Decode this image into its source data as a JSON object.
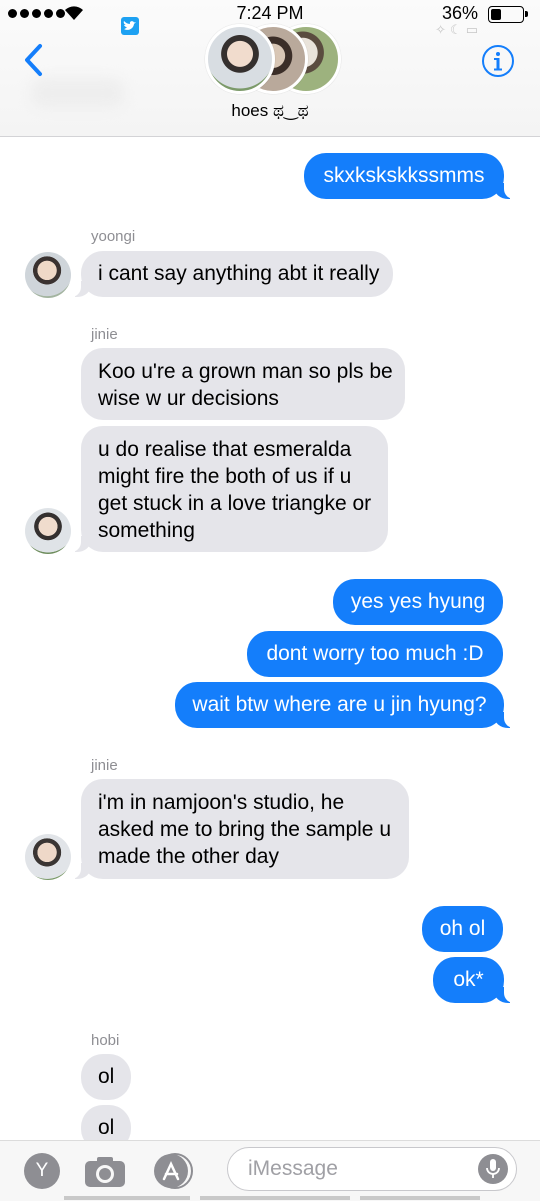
{
  "status_bar": {
    "time": "7:24 PM",
    "battery": "36%"
  },
  "header": {
    "title": "hoes ಥ‿ಥ"
  },
  "messages": [
    {
      "text": "skxkskskkssmms"
    },
    {
      "sender": "yoongi",
      "text": "i cant say anything abt it really"
    },
    {
      "sender": "jinie",
      "lines": [
        "Koo u're a grown man so pls be",
        "wise w ur decisions"
      ]
    },
    {
      "lines": [
        "u do realise that esmeralda",
        "might fire the both of us if u",
        "get stuck in a love triangke or",
        "something"
      ]
    },
    {
      "text": "yes yes hyung"
    },
    {
      "text": "dont worry too much :D"
    },
    {
      "text": "wait btw where are u jin hyung?"
    },
    {
      "sender": "jinie",
      "lines": [
        "i'm in namjoon's studio, he",
        "asked me to bring the sample u",
        "made the other day"
      ]
    },
    {
      "text": "oh ol"
    },
    {
      "text": "ok*"
    },
    {
      "sender": "hobi",
      "text": "ol"
    },
    {
      "text": "ol"
    }
  ],
  "composer": {
    "app_letter": "Y",
    "placeholder": "iMessage"
  },
  "colors": {
    "outgoing": "#147efb",
    "incoming": "#e5e5ea",
    "ios_blue": "#147efb"
  }
}
